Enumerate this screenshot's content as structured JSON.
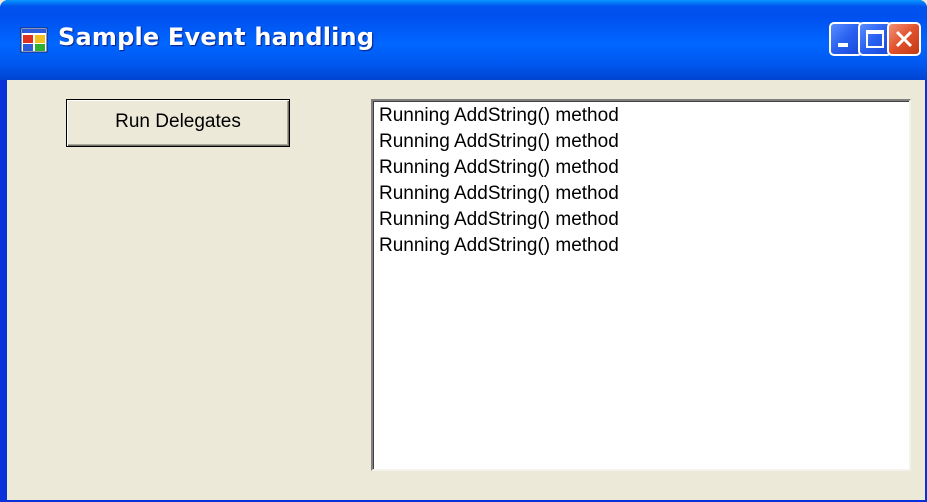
{
  "window": {
    "title": "Sample Event handling",
    "icon": "app-window-icon",
    "controls": [
      "minimize-icon",
      "maximize-icon",
      "close-icon"
    ]
  },
  "main": {
    "run_button_label": "Run Delegates",
    "list_items": [
      "Running AddString() method",
      "Running AddString() method",
      "Running AddString() method",
      "Running AddString() method",
      "Running AddString() method",
      "Running AddString() method"
    ]
  },
  "colors": {
    "titlebar": "#0058ee",
    "frame": "#ece9d8",
    "close_button": "#e0512c"
  }
}
